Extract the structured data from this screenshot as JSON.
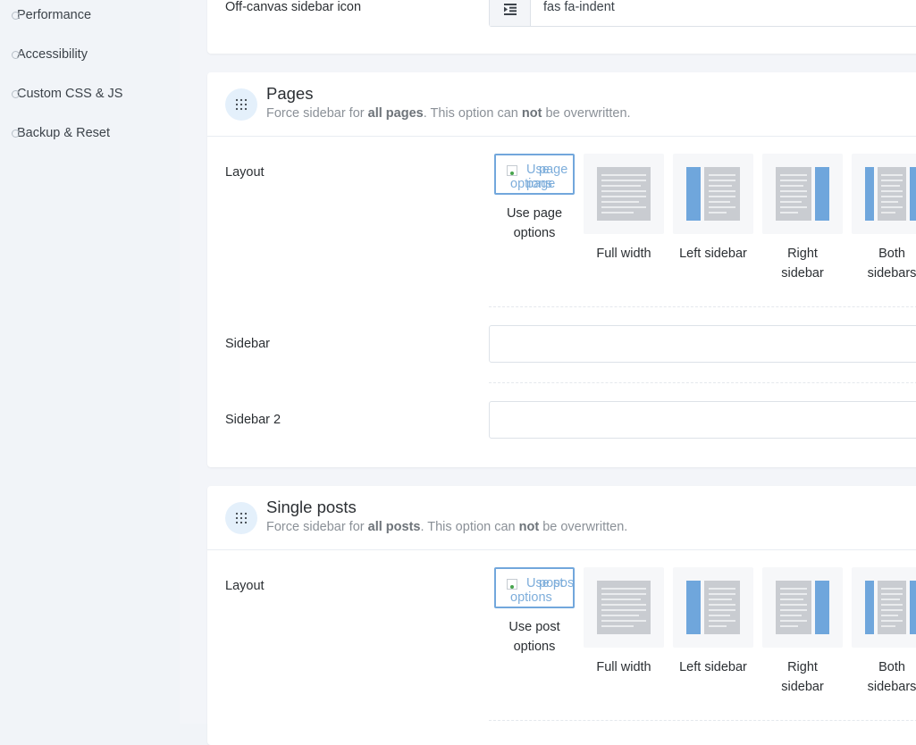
{
  "sidebar": {
    "items": [
      {
        "label": "Performance"
      },
      {
        "label": "Accessibility"
      },
      {
        "label": "Custom CSS & JS"
      },
      {
        "label": "Backup & Reset"
      }
    ]
  },
  "offcanvas": {
    "label": "Off-canvas sidebar icon",
    "value": "fas fa-indent",
    "icon": "indent-icon"
  },
  "pages": {
    "title": "Pages",
    "subtitle_prefix": "Force sidebar for ",
    "subtitle_bold1": "all pages",
    "subtitle_mid": ". This option can ",
    "subtitle_bold2": "not",
    "subtitle_suffix": " be overwritten.",
    "layout_label": "Layout",
    "selected_alt_line1": "Use page",
    "selected_alt_line2": "options",
    "selected_overlap": "page",
    "options": [
      {
        "label_1": "Use page",
        "label_2": "options"
      },
      {
        "label_1": "Full width",
        "label_2": ""
      },
      {
        "label_1": "Left sidebar",
        "label_2": ""
      },
      {
        "label_1": "Right",
        "label_2": "sidebar"
      },
      {
        "label_1": "Both",
        "label_2": "sidebars"
      }
    ],
    "sidebar_label": "Sidebar",
    "sidebar2_label": "Sidebar 2"
  },
  "posts": {
    "title": "Single posts",
    "subtitle_prefix": "Force sidebar for ",
    "subtitle_bold1": "all posts",
    "subtitle_mid": ". This option can ",
    "subtitle_bold2": "not",
    "subtitle_suffix": " be overwritten.",
    "layout_label": "Layout",
    "selected_alt_line1": "Use post",
    "selected_alt_line2": "options",
    "selected_overlap": "post",
    "options": [
      {
        "label_1": "Use post",
        "label_2": "options"
      },
      {
        "label_1": "Full width",
        "label_2": ""
      },
      {
        "label_1": "Left sidebar",
        "label_2": ""
      },
      {
        "label_1": "Right",
        "label_2": "sidebar"
      },
      {
        "label_1": "Both",
        "label_2": "sidebars"
      }
    ]
  },
  "colors": {
    "accent": "#72a7dc",
    "sidebar_blue": "#6fa6dc",
    "page_gray": "#c9ccd1"
  }
}
